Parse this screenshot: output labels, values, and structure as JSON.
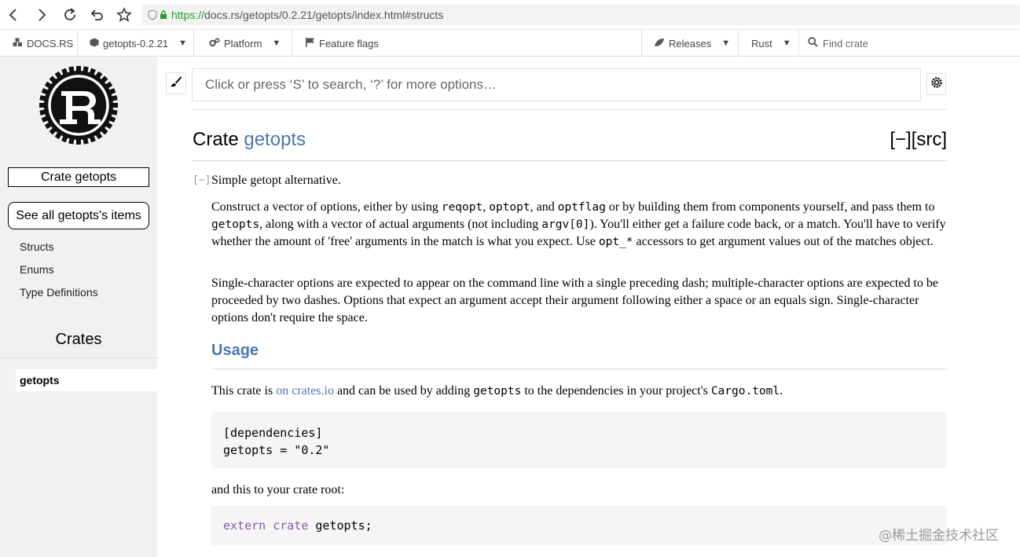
{
  "browser": {
    "url_protocol": "https://",
    "url_rest": "docs.rs/getopts/0.2.21/getopts/index.html#structs"
  },
  "docsrs_nav": {
    "logo_label": "DOCS.RS",
    "crate_version": "getopts-0.2.21",
    "platform": "Platform",
    "feature_flags": "Feature flags",
    "releases": "Releases",
    "rust": "Rust",
    "find_crate": "Find crate"
  },
  "sidebar": {
    "crate_label": "Crate getopts",
    "see_all": "See all getopts's items",
    "links": [
      "Structs",
      "Enums",
      "Type Definitions"
    ],
    "crates_heading": "Crates",
    "crate_item": "getopts"
  },
  "search": {
    "placeholder": "Click or press ‘S’ to search, ‘?’ for more options…"
  },
  "main": {
    "title_prefix": "Crate ",
    "title_name": "getopts",
    "out_of_band": "[−][src]",
    "collapse_toggle": "[−]",
    "summary": "Simple getopt alternative.",
    "p1": [
      {
        "t": "Construct a vector of options, either by using "
      },
      {
        "c": "reqopt"
      },
      {
        "t": ", "
      },
      {
        "c": "optopt"
      },
      {
        "t": ", and "
      },
      {
        "c": "optflag"
      },
      {
        "t": " or by building them from components yourself, and pass them to "
      },
      {
        "c": "getopts"
      },
      {
        "t": ", along with a vector of actual arguments (not including "
      },
      {
        "c": "argv[0]"
      },
      {
        "t": "). You'll either get a failure code back, or a match. You'll have to verify whether the amount of 'free' arguments in the match is what you expect. Use "
      },
      {
        "c": "opt_*"
      },
      {
        "t": " accessors to get argument values out of the matches object."
      }
    ],
    "p2": [
      {
        "t": "Single-character options are expected to appear on the command line with a single preceding dash; multiple-character options are expected to be proceeded by two dashes. Options that expect an argument accept their argument following either a space or an equals sign. Single-character options don't require the space."
      }
    ],
    "usage_heading": "Usage",
    "p3": [
      {
        "t": "This crate is "
      },
      {
        "a": "on crates.io"
      },
      {
        "t": " and can be used by adding "
      },
      {
        "c": "getopts"
      },
      {
        "t": " to the dependencies in your project's "
      },
      {
        "c": "Cargo.toml"
      },
      {
        "t": "."
      }
    ],
    "code1_line1": "[dependencies]",
    "code1_line2": "getopts = \"0.2\"",
    "p4": "and this to your crate root:",
    "code2_kw1": "extern",
    "code2_kw2": "crate",
    "code2_rest": "getopts;"
  },
  "watermark": "@稀土掘金技术社区"
}
